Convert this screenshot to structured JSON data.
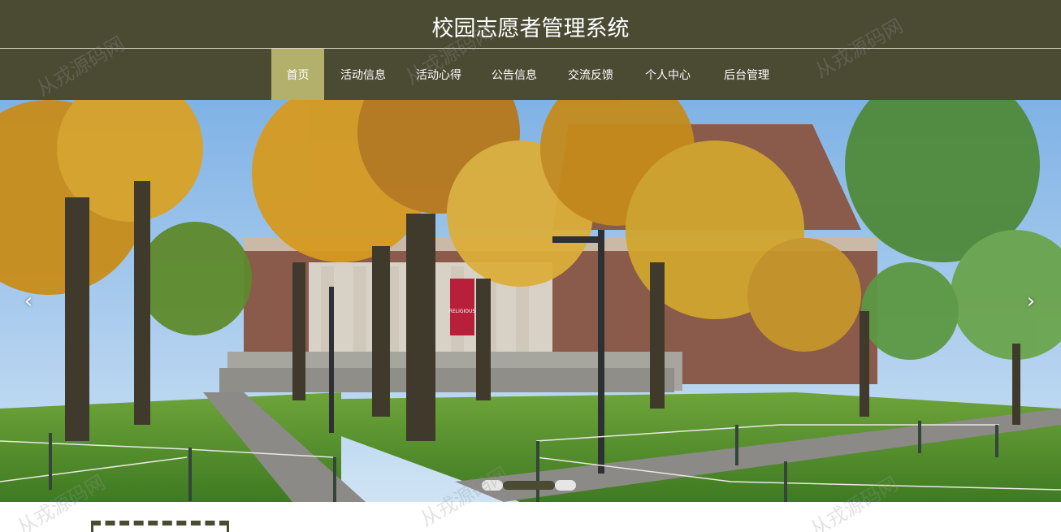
{
  "header": {
    "title": "校园志愿者管理系统"
  },
  "nav": {
    "items": [
      {
        "label": "首页",
        "active": true
      },
      {
        "label": "活动信息",
        "active": false
      },
      {
        "label": "活动心得",
        "active": false
      },
      {
        "label": "公告信息",
        "active": false
      },
      {
        "label": "交流反馈",
        "active": false
      },
      {
        "label": "个人中心",
        "active": false
      },
      {
        "label": "后台管理",
        "active": false
      }
    ]
  },
  "carousel": {
    "prev_icon": "‹",
    "next_icon": "›",
    "slide_count": 3,
    "active_index": 1,
    "banner": "RELIGIOUS"
  },
  "watermark": {
    "text": "从戎源码网"
  },
  "colors": {
    "header_bg": "#4b4a33",
    "nav_active": "#b2b06a",
    "text": "#ffffff"
  }
}
